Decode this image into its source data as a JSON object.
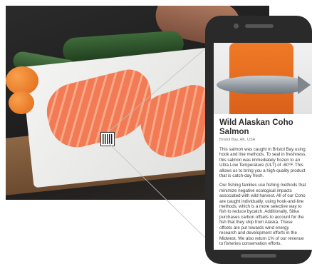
{
  "product": {
    "title": "Wild Alaskan Coho Salmon",
    "location": "Bristol Bay, AK, USA",
    "paragraphs": [
      "This salmon was caught in Bristol Bay using hook and line methods. To seal in freshness, this salmon was immediately frozen to an Ultra Low Temperature (ULT) of -60°F. This allows us to bring you a high-quality product that is catch-day fresh.",
      "Our fishing families use fishing methods that minimize negative ecological impacts associated with wild harvest. All of our Coho are caught individually, using hook-and-line methods, which is a more selective way to fish to reduce bycatch. Additionally, Sitka purchases carbon offsets to account for the fish that they ship from Alaska. These offsets are put towards wind energy research and development efforts in the Midwest. We also return 1% of our revenue to fisheries conservation efforts."
    ]
  },
  "icons": {
    "qr": "qr-code-icon"
  }
}
